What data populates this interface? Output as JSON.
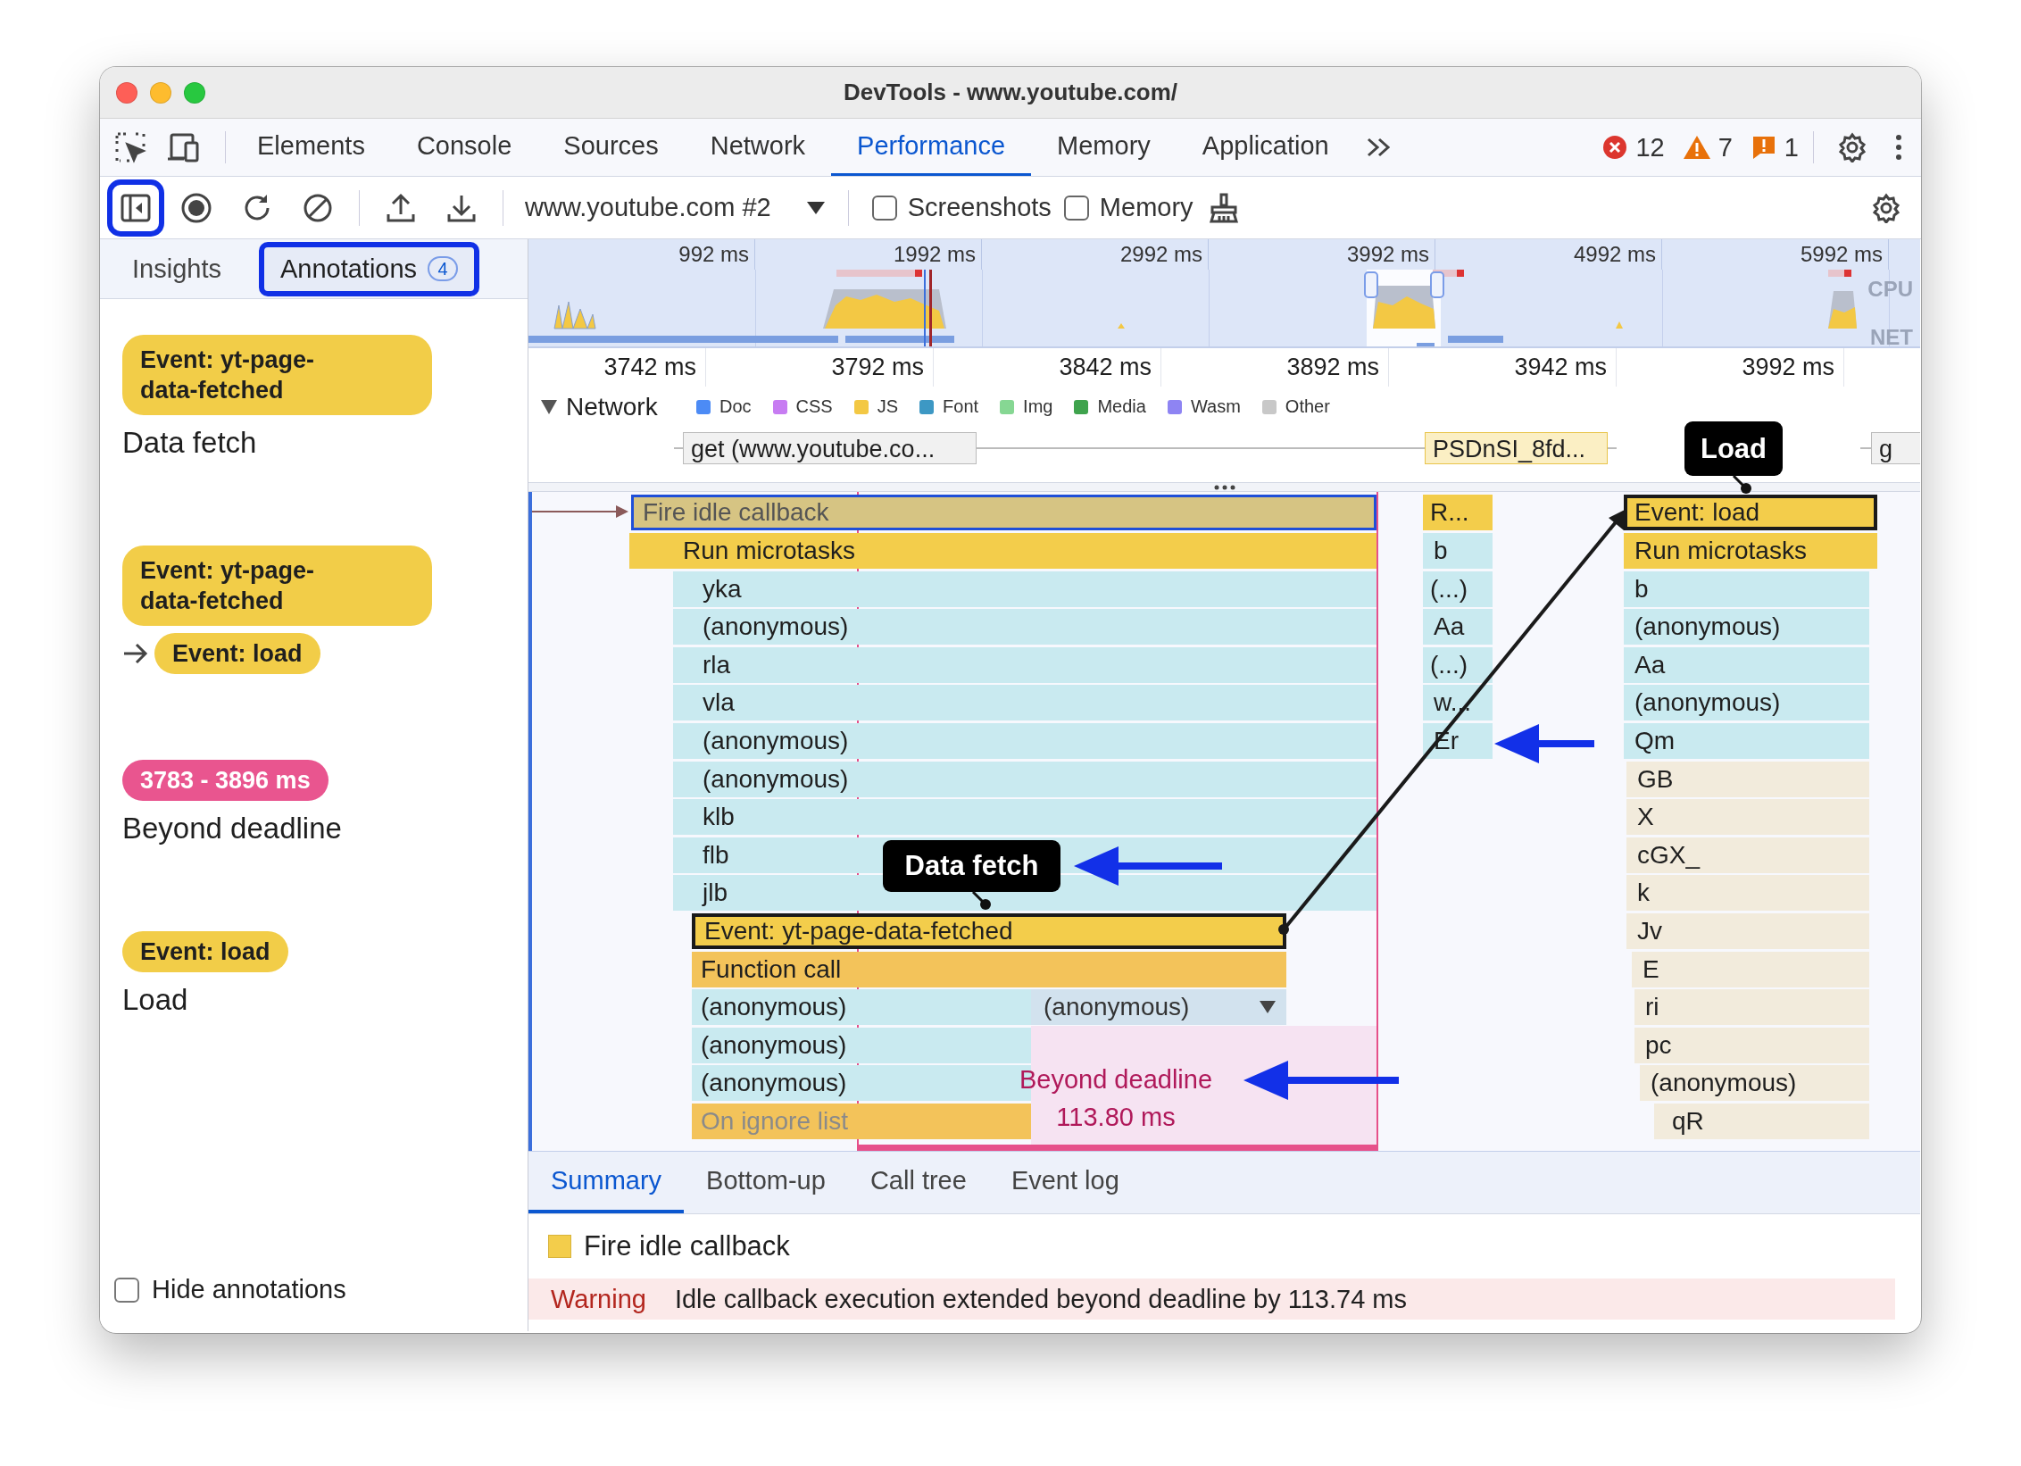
{
  "window": {
    "title": "DevTools - www.youtube.com/"
  },
  "tabs": [
    {
      "label": "Elements",
      "selected": false
    },
    {
      "label": "Console",
      "selected": false
    },
    {
      "label": "Sources",
      "selected": false
    },
    {
      "label": "Network",
      "selected": false
    },
    {
      "label": "Performance",
      "selected": true
    },
    {
      "label": "Memory",
      "selected": false
    },
    {
      "label": "Application",
      "selected": false
    }
  ],
  "issue_counts": [
    {
      "kind": "error",
      "count": "12"
    },
    {
      "kind": "warning",
      "count": "7"
    },
    {
      "kind": "issue",
      "count": "1"
    }
  ],
  "toolbar": {
    "sidebar_toggle": {
      "highlighted": true
    },
    "recording": "www.youtube.com #2",
    "checkboxes": [
      {
        "label": "Screenshots",
        "checked": false
      },
      {
        "label": "Memory",
        "checked": false
      }
    ]
  },
  "sidebar": {
    "tabs": [
      {
        "label": "Insights",
        "selected": false,
        "highlighted": false
      },
      {
        "label": "Annotations",
        "count": "4",
        "selected": true,
        "highlighted": true
      }
    ],
    "annotations": [
      {
        "kind": "entry",
        "entries": [
          "Event: yt-page-data-fetched"
        ],
        "label": "Data fetch"
      },
      {
        "kind": "link",
        "entries": [
          "Event: yt-page-data-fetched",
          "Event: load"
        ]
      },
      {
        "kind": "range",
        "range": "3783 - 3896 ms",
        "label": "Beyond deadline"
      },
      {
        "kind": "entry",
        "entries": [
          "Event: load"
        ],
        "label": "Load"
      }
    ],
    "hide_annotations": {
      "label": "Hide annotations",
      "checked": false
    }
  },
  "overview": {
    "ticks": [
      "992 ms",
      "1992 ms",
      "2992 ms",
      "3992 ms",
      "4992 ms",
      "5992 ms"
    ],
    "tracks": [
      "CPU",
      "NET"
    ]
  },
  "ruler": {
    "ticks": [
      "3742 ms",
      "3792 ms",
      "3842 ms",
      "3892 ms",
      "3942 ms",
      "3992 ms"
    ]
  },
  "network": {
    "label": "Network",
    "expanded": true,
    "legend": [
      {
        "label": "Doc",
        "color": "#4c8bf5"
      },
      {
        "label": "CSS",
        "color": "#c77cf2"
      },
      {
        "label": "JS",
        "color": "#f3c844"
      },
      {
        "label": "Font",
        "color": "#3d98c4"
      },
      {
        "label": "Img",
        "color": "#86d793"
      },
      {
        "label": "Media",
        "color": "#3fa34d"
      },
      {
        "label": "Wasm",
        "color": "#8e84f3"
      },
      {
        "label": "Other",
        "color": "#c8c8c8"
      }
    ],
    "requests": [
      {
        "label": "get (www.youtube.co...",
        "kind": "other"
      },
      {
        "label": "PSDnSI_8fd...",
        "kind": "js"
      },
      {
        "label": "g",
        "kind": "other"
      }
    ]
  },
  "flame_chart": {
    "entries": [
      {
        "label": "Fire idle callback",
        "kind": "task",
        "selected": true,
        "annotated": false
      },
      {
        "label": "Run microtasks",
        "kind": "task",
        "selected": false,
        "annotated": false
      },
      {
        "label": "yka",
        "kind": "js",
        "selected": false,
        "annotated": false
      },
      {
        "label": "(anonymous)",
        "kind": "js",
        "selected": false,
        "annotated": false
      },
      {
        "label": "rla",
        "kind": "js",
        "selected": false,
        "annotated": false
      },
      {
        "label": "vla",
        "kind": "js",
        "selected": false,
        "annotated": false
      },
      {
        "label": "(anonymous)",
        "kind": "js",
        "selected": false,
        "annotated": false
      },
      {
        "label": "(anonymous)",
        "kind": "js",
        "selected": false,
        "annotated": false
      },
      {
        "label": "klb",
        "kind": "js",
        "selected": false,
        "annotated": false
      },
      {
        "label": "flb",
        "kind": "js",
        "selected": false,
        "annotated": false
      },
      {
        "label": "jlb",
        "kind": "js",
        "selected": false,
        "annotated": false
      },
      {
        "label": "Event: yt-page-data-fetched",
        "kind": "task",
        "selected": false,
        "annotated": true
      },
      {
        "label": "Function call",
        "kind": "function",
        "selected": false,
        "annotated": false
      },
      {
        "label": "(anonymous)",
        "kind": "js",
        "selected": false,
        "annotated": false
      },
      {
        "label": "(anonymous)",
        "kind": "collapsed",
        "selected": false,
        "annotated": false
      },
      {
        "label": "(anonymous)",
        "kind": "js",
        "selected": false,
        "annotated": false
      },
      {
        "label": "(anonymous)",
        "kind": "js",
        "selected": false,
        "annotated": false
      },
      {
        "label": "On ignore list",
        "kind": "ignored",
        "selected": false,
        "annotated": false
      },
      {
        "label": "R...",
        "kind": "task",
        "selected": false,
        "annotated": false
      },
      {
        "label": "b",
        "kind": "js",
        "selected": false,
        "annotated": false
      },
      {
        "label": "(...)",
        "kind": "js",
        "selected": false,
        "annotated": false
      },
      {
        "label": "Aa",
        "kind": "js",
        "selected": false,
        "annotated": false
      },
      {
        "label": "(...)",
        "kind": "js",
        "selected": false,
        "annotated": false
      },
      {
        "label": "w...",
        "kind": "js",
        "selected": false,
        "annotated": false
      },
      {
        "label": "Er",
        "kind": "js",
        "selected": false,
        "annotated": false
      },
      {
        "label": "Event: load",
        "kind": "task",
        "selected": false,
        "annotated": true
      },
      {
        "label": "Run microtasks",
        "kind": "task",
        "selected": false,
        "annotated": false
      },
      {
        "label": "b",
        "kind": "js",
        "selected": false,
        "annotated": false
      },
      {
        "label": "(anonymous)",
        "kind": "js",
        "selected": false,
        "annotated": false
      },
      {
        "label": "Aa",
        "kind": "js",
        "selected": false,
        "annotated": false
      },
      {
        "label": "(anonymous)",
        "kind": "js",
        "selected": false,
        "annotated": false
      },
      {
        "label": "Qm",
        "kind": "js",
        "selected": false,
        "annotated": false
      },
      {
        "label": "GB",
        "kind": "library",
        "selected": false,
        "annotated": false
      },
      {
        "label": "X",
        "kind": "library",
        "selected": false,
        "annotated": false
      },
      {
        "label": "cGX_",
        "kind": "library",
        "selected": false,
        "annotated": false
      },
      {
        "label": "k",
        "kind": "library",
        "selected": false,
        "annotated": false
      },
      {
        "label": "Jv",
        "kind": "library",
        "selected": false,
        "annotated": false
      },
      {
        "label": "E",
        "kind": "library",
        "selected": false,
        "annotated": false
      },
      {
        "label": "ri",
        "kind": "library",
        "selected": false,
        "annotated": false
      },
      {
        "label": "pc",
        "kind": "library",
        "selected": false,
        "annotated": false
      },
      {
        "label": "(anonymous)",
        "kind": "library",
        "selected": false,
        "annotated": false
      },
      {
        "label": "qR",
        "kind": "library",
        "selected": false,
        "annotated": false
      }
    ],
    "labels": [
      {
        "text": "Load"
      },
      {
        "text": "Data fetch"
      }
    ],
    "range": {
      "label": "Beyond deadline",
      "duration": "113.80 ms"
    }
  },
  "details": {
    "tabs": [
      {
        "label": "Summary",
        "selected": true
      },
      {
        "label": "Bottom-up",
        "selected": false
      },
      {
        "label": "Call tree",
        "selected": false
      },
      {
        "label": "Event log",
        "selected": false
      }
    ],
    "title": "Fire idle callback",
    "warning": {
      "label": "Warning",
      "text": "Idle callback execution extended beyond deadline by 113.74 ms"
    }
  }
}
